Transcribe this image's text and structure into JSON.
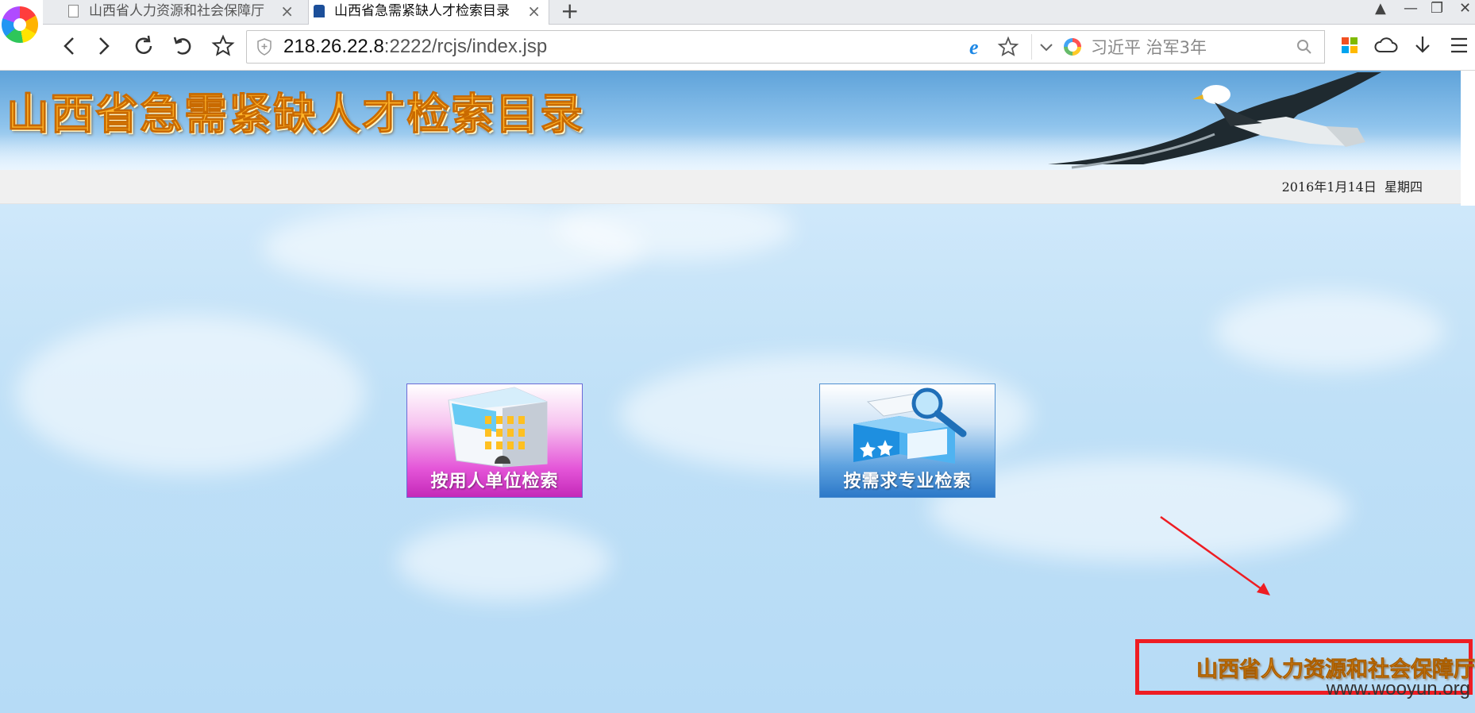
{
  "browser": {
    "tabs": [
      {
        "title": "山西省人力资源和社会保障厅",
        "active": false
      },
      {
        "title": "山西省急需紧缺人才检索目录",
        "active": true
      }
    ],
    "url": {
      "host": "218.26.22.8",
      "path": ":2222/rcjs/index.jsp"
    },
    "search_value": "习近平 治军3年"
  },
  "page": {
    "banner_title": "山西省急需紧缺人才检索目录",
    "date_text": "2016年1月14日  星期四",
    "buttons": {
      "by_employer": "按用人单位检索",
      "by_major": "按需求专业检索"
    },
    "footer_dept": "山西省人力资源和社会保障厅",
    "watermark": "www.wooyun.org"
  },
  "colors": {
    "banner_title": "#ffb52a",
    "employer_tile": "#e455d8",
    "major_tile": "#2c78c8",
    "annotation_red": "#ee1d23"
  }
}
